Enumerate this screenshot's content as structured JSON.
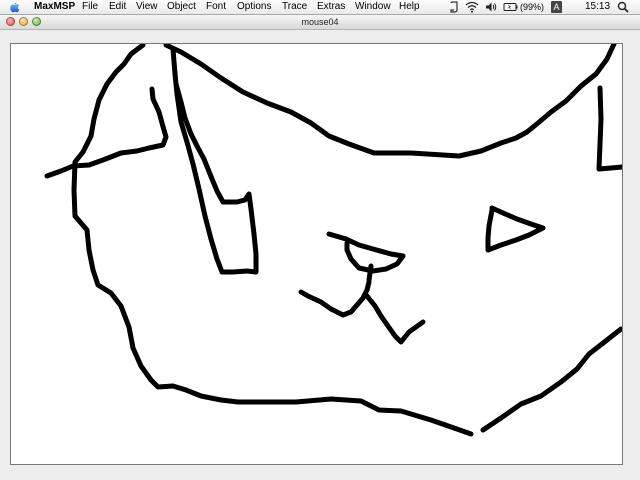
{
  "menubar": {
    "app_name": "MaxMSP",
    "items": [
      "File",
      "Edit",
      "View",
      "Object",
      "Font",
      "Options",
      "Trace",
      "Extras",
      "Window",
      "Help"
    ],
    "battery_text": "(99%)",
    "clock": "15:13",
    "input_menu_label": "A"
  },
  "window": {
    "title": "mouse04"
  },
  "canvas": {
    "background": "#ffffff",
    "stroke_color": "#000000"
  }
}
